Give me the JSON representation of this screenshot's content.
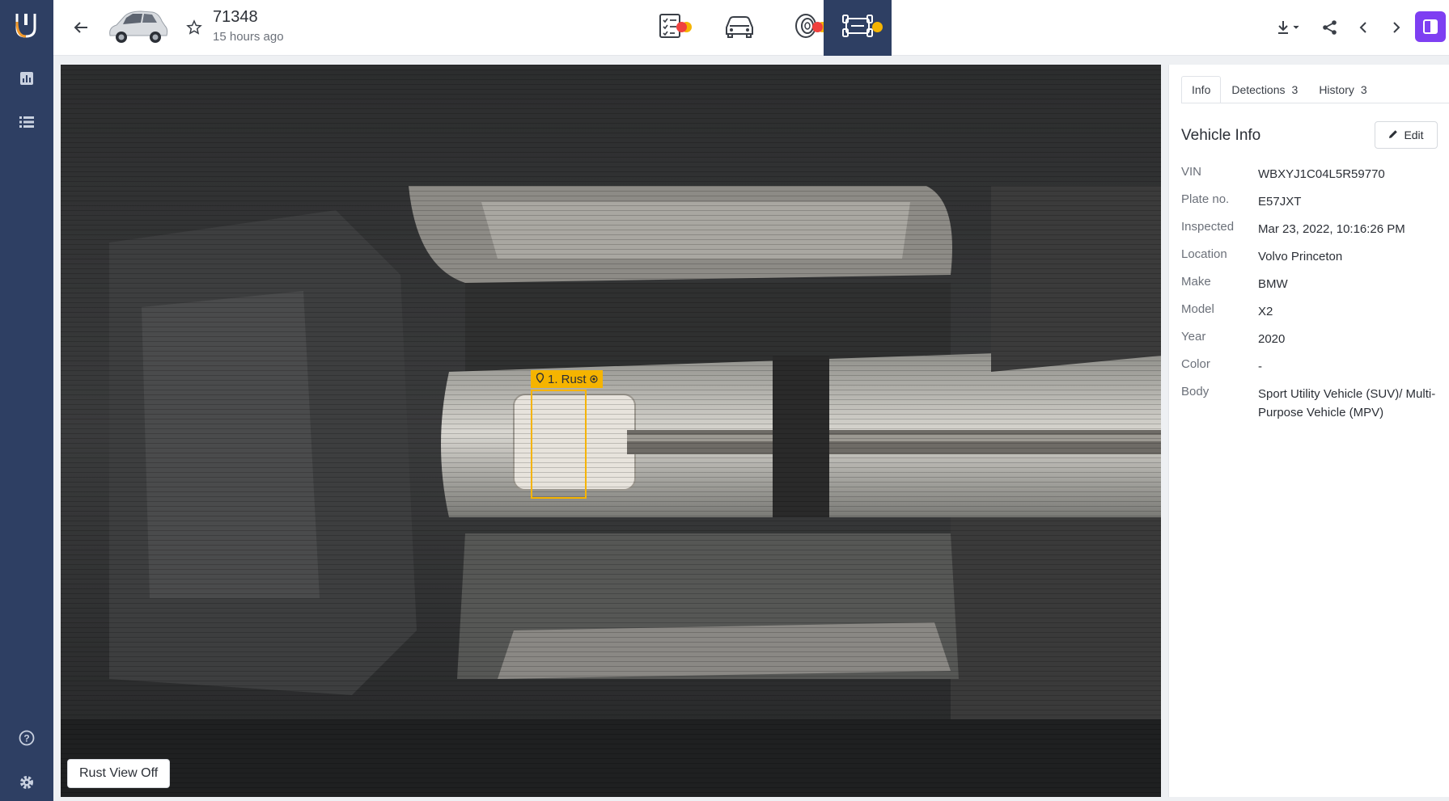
{
  "header": {
    "vehicle_id": "71348",
    "time_ago": "15 hours ago"
  },
  "modes": [
    {
      "name": "checklist",
      "status_color": "#f0413e",
      "secondary_color": "#f5b400"
    },
    {
      "name": "car-body",
      "status_color": null
    },
    {
      "name": "tires",
      "status_color": "#f0413e",
      "secondary_color": "#f5b400"
    },
    {
      "name": "undercarriage",
      "status_color": "#f5b400",
      "active": true
    }
  ],
  "viewer": {
    "detection_label": "1. Rust",
    "rust_view_button": "Rust View Off"
  },
  "sidebar": {
    "tabs": [
      {
        "label": "Info",
        "count": ""
      },
      {
        "label": "Detections",
        "count": "3"
      },
      {
        "label": "History",
        "count": "3"
      }
    ],
    "section_title": "Vehicle Info",
    "edit_label": "Edit",
    "fields": [
      {
        "key": "VIN",
        "value": "WBXYJ1C04L5R59770"
      },
      {
        "key": "Plate no.",
        "value": "E57JXT"
      },
      {
        "key": "Inspected",
        "value": "Mar 23, 2022, 10:16:26 PM"
      },
      {
        "key": "Location",
        "value": "Volvo Princeton"
      },
      {
        "key": "Make",
        "value": "BMW"
      },
      {
        "key": "Model",
        "value": "X2"
      },
      {
        "key": "Year",
        "value": "2020"
      },
      {
        "key": "Color",
        "value": "-"
      },
      {
        "key": "Body",
        "value": "Sport Utility Vehicle (SUV)/ Multi-Purpose Vehicle (MPV)"
      }
    ]
  },
  "colors": {
    "rail": "#2e3f63",
    "accent": "#7e3ff2",
    "detection": "#f5b400",
    "alert": "#f0413e"
  }
}
